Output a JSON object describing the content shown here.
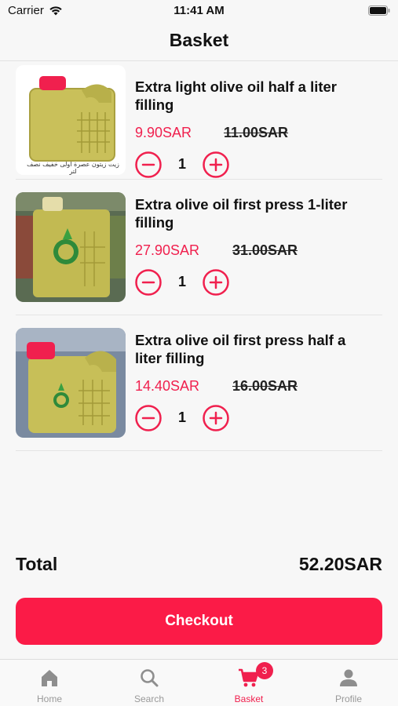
{
  "status": {
    "carrier": "Carrier",
    "time": "11:41 AM"
  },
  "nav": {
    "title": "Basket"
  },
  "items": [
    {
      "name": "Extra light olive oil half a liter filling",
      "price": "9.90SAR",
      "old_price": "11.00SAR",
      "qty": "1",
      "thumb_caption": "زيت زيتون عصرة اولى خفيف نصف لتر"
    },
    {
      "name": "Extra olive oil first press 1-liter filling",
      "price": "27.90SAR",
      "old_price": "31.00SAR",
      "qty": "1"
    },
    {
      "name": "Extra olive oil first press half a liter filling",
      "price": "14.40SAR",
      "old_price": "16.00SAR",
      "qty": "1"
    }
  ],
  "summary": {
    "total_label": "Total",
    "total_value": "52.20SAR"
  },
  "checkout": {
    "label": "Checkout"
  },
  "tabs": [
    {
      "label": "Home",
      "icon": "home-icon"
    },
    {
      "label": "Search",
      "icon": "search-icon"
    },
    {
      "label": "Basket",
      "icon": "cart-icon",
      "badge": "3",
      "active": true
    },
    {
      "label": "Profile",
      "icon": "person-icon"
    }
  ],
  "colors": {
    "accent": "#f0204e",
    "button": "#fb1b47"
  }
}
